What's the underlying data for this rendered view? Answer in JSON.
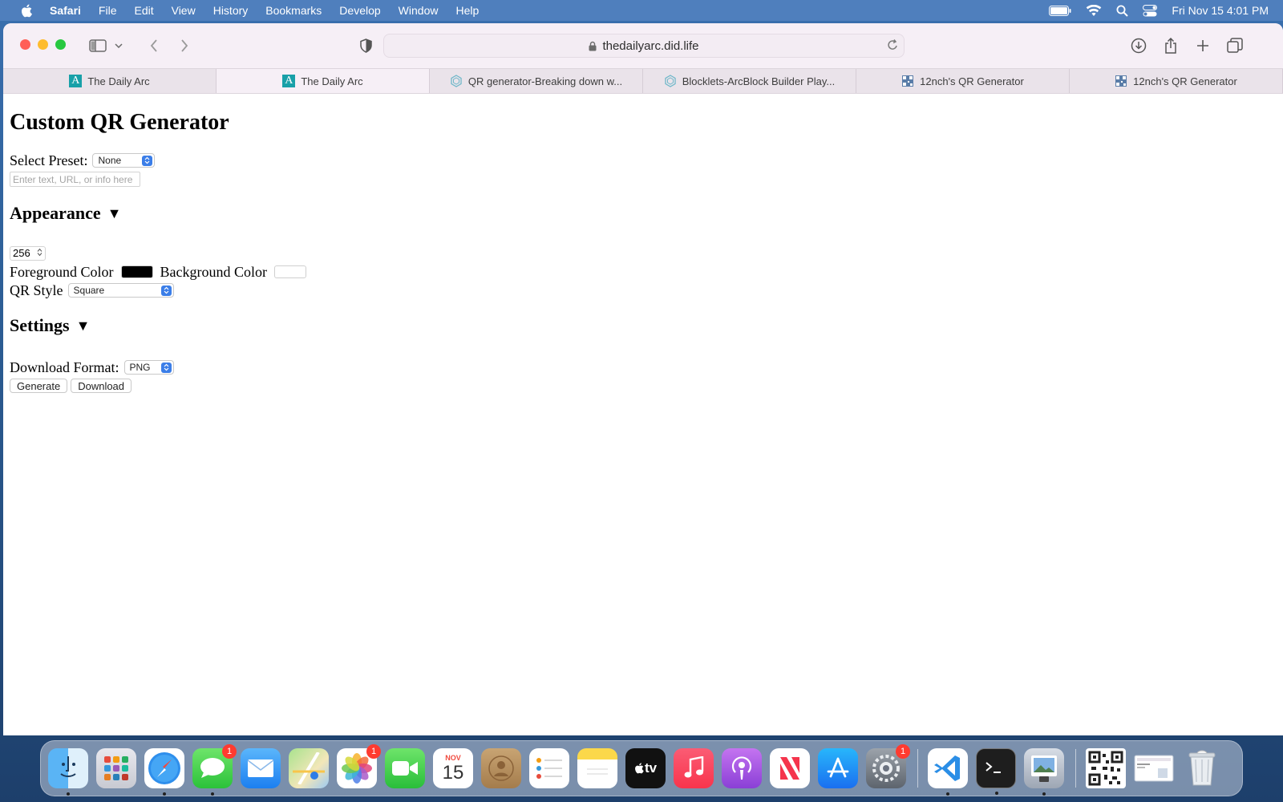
{
  "menubar": {
    "app_name": "Safari",
    "items": [
      "File",
      "Edit",
      "View",
      "History",
      "Bookmarks",
      "Develop",
      "Window",
      "Help"
    ],
    "clock": "Fri Nov 15  4:01 PM"
  },
  "browser": {
    "url": "thedailyarc.did.life",
    "tabs": [
      {
        "title": "The Daily Arc",
        "icon": "arc-logo-icon",
        "active": false
      },
      {
        "title": "The Daily Arc",
        "icon": "arc-logo-icon",
        "active": true
      },
      {
        "title": "QR generator-Breaking down w...",
        "icon": "hexagon-logo-icon",
        "active": false
      },
      {
        "title": "Blocklets-ArcBlock Builder Play...",
        "icon": "hexagon-logo-icon",
        "active": false
      },
      {
        "title": "12nch's QR Generator",
        "icon": "qr-favicon-icon",
        "active": false
      },
      {
        "title": "12nch's QR Generator",
        "icon": "qr-favicon-icon",
        "active": false
      }
    ]
  },
  "page": {
    "title": "Custom QR Generator",
    "preset_label": "Select Preset:",
    "preset_value": "None",
    "input_placeholder": "Enter text, URL, or info here",
    "appearance_heading": "Appearance",
    "appearance_toggle": "▼",
    "size_value": "256",
    "foreground_label": "Foreground Color",
    "foreground_color": "#000000",
    "background_label": "Background Color",
    "background_color": "#ffffff",
    "qr_style_label": "QR Style",
    "qr_style_value": "Square",
    "settings_heading": "Settings",
    "settings_toggle": "▼",
    "download_format_label": "Download Format:",
    "download_format_value": "PNG",
    "generate_button": "Generate",
    "download_button": "Download"
  },
  "dock": {
    "calendar_month": "NOV",
    "calendar_day": "15",
    "tv_label": "tv",
    "badges": {
      "messages": "1",
      "photos": "1",
      "settings": "1"
    },
    "apps": [
      "finder",
      "launchpad",
      "safari",
      "messages",
      "mail",
      "maps",
      "photos",
      "facetime",
      "calendar",
      "contacts",
      "reminders",
      "notes",
      "apple-tv",
      "music",
      "podcasts",
      "news",
      "app-store",
      "system-settings",
      "vscode",
      "terminal",
      "preview",
      "qr-image",
      "screenshot",
      "trash"
    ]
  },
  "colors": {
    "accent_blue": "#3b7ee8",
    "menubar": "#4f7fbd",
    "toolbar": "#f6eff6"
  }
}
